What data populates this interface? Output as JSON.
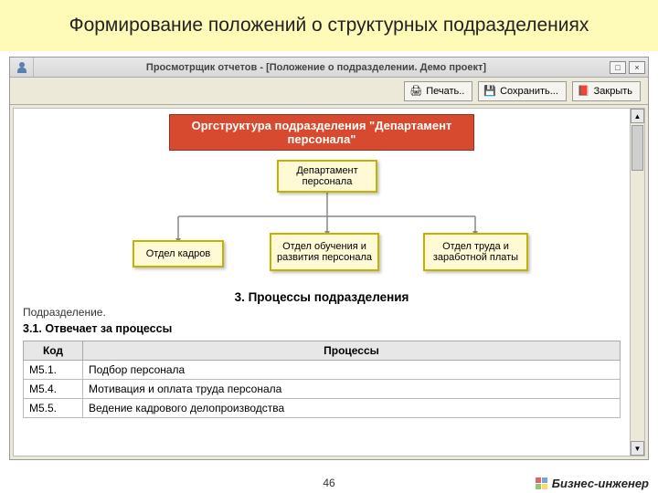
{
  "slide": {
    "title": "Формирование положений о структурных подразделениях"
  },
  "window": {
    "title": "Просмотрщик отчетов - [Положение о подразделении. Демо проект]"
  },
  "toolbar": {
    "print": "Печать..",
    "save": "Сохранить...",
    "close": "Закрыть"
  },
  "org": {
    "title": "Оргструктура подразделения \"Департамент персонала\"",
    "top": "Департамент персонала",
    "child1": "Отдел кадров",
    "child2": "Отдел обучения и развития персонала",
    "child3": "Отдел труда и заработной платы"
  },
  "section": {
    "heading": "3. Процессы подразделения",
    "sub_label": "Подразделение.",
    "sub_bold": "3.1. Отвечает за процессы"
  },
  "table": {
    "col_code": "Код",
    "col_proc": "Процессы",
    "rows": [
      {
        "code": "М5.1.",
        "proc": "Подбор персонала"
      },
      {
        "code": "М5.4.",
        "proc": "Мотивация и оплата труда персонала"
      },
      {
        "code": "М5.5.",
        "proc": "Ведение кадрового делопроизводства"
      }
    ]
  },
  "footer": {
    "page": "46",
    "brand": "Бизнес-инженер"
  }
}
